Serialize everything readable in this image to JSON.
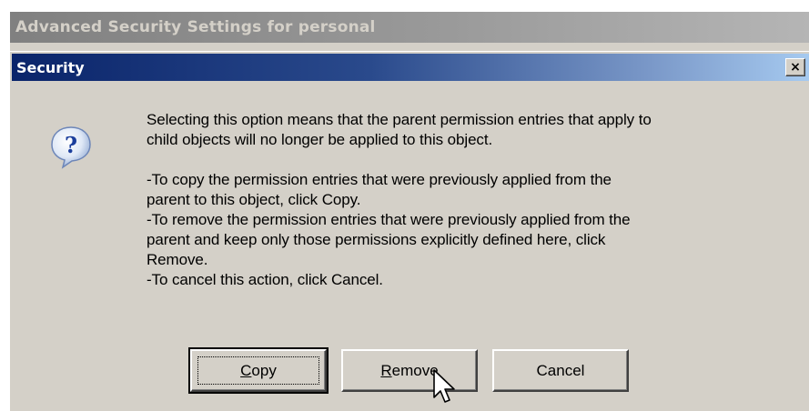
{
  "parent_window": {
    "title": "Advanced Security Settings for personal"
  },
  "dialog": {
    "title": "Security",
    "close_label": "×",
    "icon": "question-icon",
    "message": {
      "line1": "Selecting this option means that the parent permission entries that apply to",
      "line2": "child objects will no longer be applied to this object.",
      "copy_line1": "-To copy  the permission entries that were previously applied from the",
      "copy_line2": "parent to this object, click Copy.",
      "remove_line1": "-To remove the permission entries that were previously applied from the",
      "remove_line2": "parent and keep only those permissions explicitly defined here, click",
      "remove_line3": "Remove.",
      "cancel_line": "-To cancel this action, click Cancel."
    },
    "buttons": {
      "copy": {
        "mnemonic": "C",
        "rest": "opy"
      },
      "remove": {
        "mnemonic": "R",
        "rest": "emove"
      },
      "cancel": {
        "label": "Cancel"
      }
    }
  },
  "colors": {
    "face": "#d4d0c8",
    "active_title_start": "#0a246a",
    "active_title_end": "#a6caf0",
    "inactive_title": "#808080"
  }
}
